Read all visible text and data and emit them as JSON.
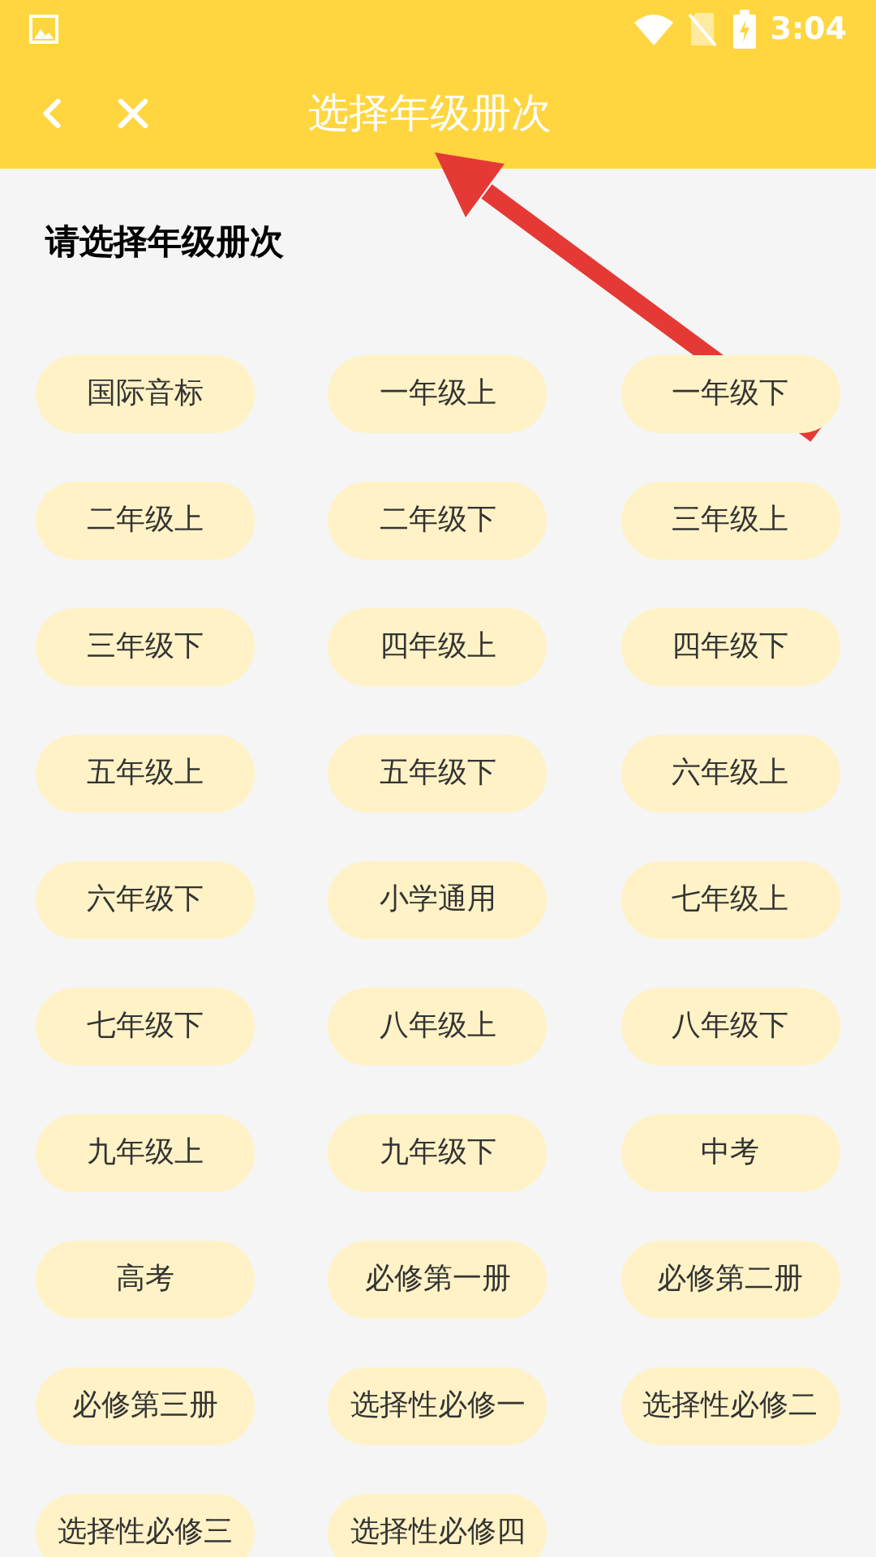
{
  "status_bar": {
    "time": "3:04"
  },
  "header": {
    "title": "选择年级册次"
  },
  "heading": "请选择年级册次",
  "grades": [
    {
      "label": "国际音标"
    },
    {
      "label": "一年级上"
    },
    {
      "label": "一年级下"
    },
    {
      "label": "二年级上"
    },
    {
      "label": "二年级下"
    },
    {
      "label": "三年级上"
    },
    {
      "label": "三年级下"
    },
    {
      "label": "四年级上"
    },
    {
      "label": "四年级下"
    },
    {
      "label": "五年级上"
    },
    {
      "label": "五年级下"
    },
    {
      "label": "六年级上"
    },
    {
      "label": "六年级下"
    },
    {
      "label": "小学通用"
    },
    {
      "label": "七年级上"
    },
    {
      "label": "七年级下"
    },
    {
      "label": "八年级上"
    },
    {
      "label": "八年级下"
    },
    {
      "label": "九年级上"
    },
    {
      "label": "九年级下"
    },
    {
      "label": "中考"
    },
    {
      "label": "高考"
    },
    {
      "label": "必修第一册"
    },
    {
      "label": "必修第二册"
    },
    {
      "label": "必修第三册"
    },
    {
      "label": "选择性必修一"
    },
    {
      "label": "选择性必修二"
    },
    {
      "label": "选择性必修三"
    },
    {
      "label": "选择性必修四"
    }
  ]
}
